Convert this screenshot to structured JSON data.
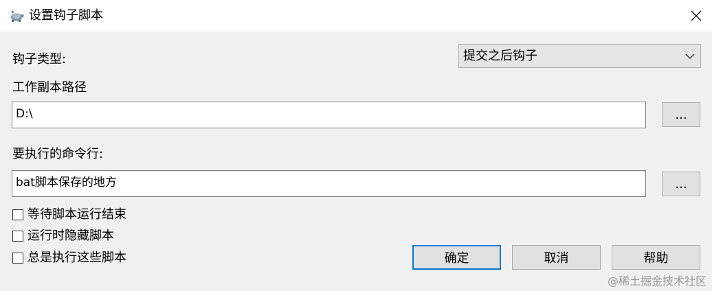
{
  "window": {
    "title": "设置钩子脚本",
    "icon": "tortoise-app-icon",
    "close": "close-icon"
  },
  "hook_type": {
    "label": "钩子类型:",
    "selected": "提交之后钩子"
  },
  "working_copy": {
    "label": "工作副本路径",
    "value": "D:\\",
    "browse": "..."
  },
  "command": {
    "label": "要执行的命令行:",
    "value": "bat脚本保存的地方",
    "browse": "..."
  },
  "options": [
    {
      "label": "等待脚本运行结束",
      "checked": false
    },
    {
      "label": "运行时隐藏脚本",
      "checked": false
    },
    {
      "label": "总是执行这些脚本",
      "checked": false
    }
  ],
  "buttons": {
    "ok": "确定",
    "cancel": "取消",
    "help": "帮助"
  },
  "watermark": "@稀土掘金技术社区"
}
